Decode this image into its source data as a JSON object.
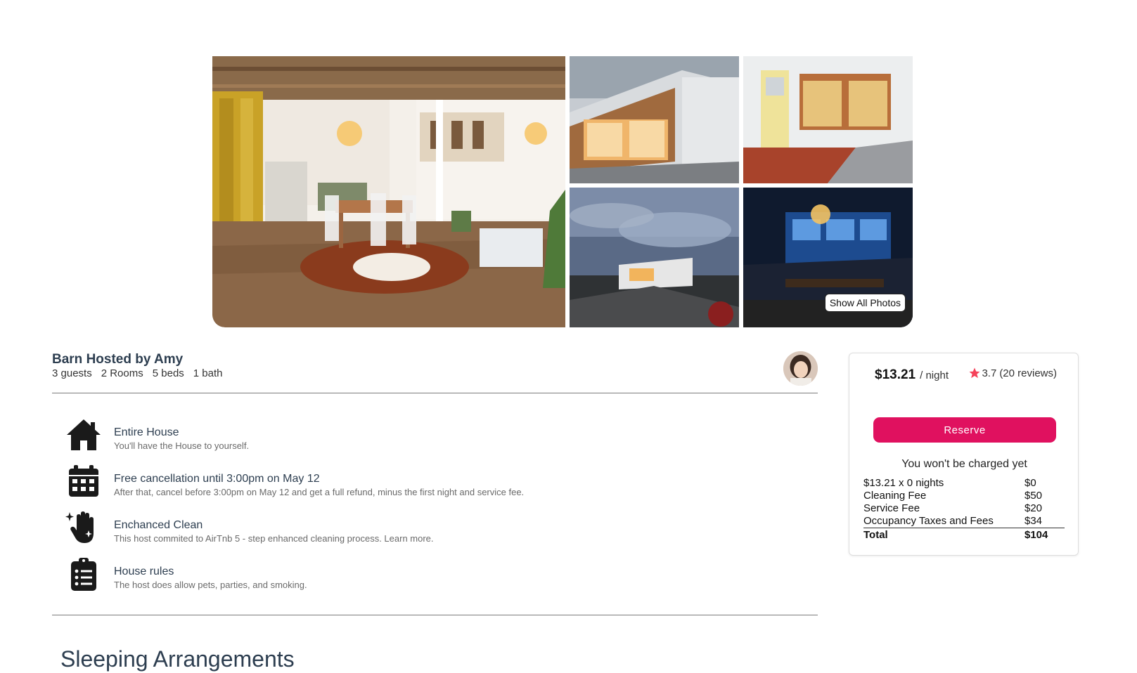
{
  "gallery": {
    "photos": [
      {
        "icon": "photo-barn-interior",
        "alt": ""
      },
      {
        "icon": "photo-barn-exterior-garage",
        "alt": ""
      },
      {
        "icon": "photo-barn-entrance-door",
        "alt": ""
      },
      {
        "icon": "photo-barn-dusk",
        "alt": ""
      },
      {
        "icon": "photo-barn-night-dining",
        "alt": ""
      }
    ],
    "show_all_label": "Show All Photos"
  },
  "listing": {
    "title": "Barn Hosted by Amy",
    "specs": [
      "3 guests",
      "2 Rooms",
      "5 beds",
      "1 bath"
    ],
    "host_avatar_icon": "host-avatar"
  },
  "highlights": [
    {
      "icon": "house-icon",
      "title": "Entire House",
      "subtitle": "You'll have the House to yourself."
    },
    {
      "icon": "calendar-icon",
      "title": "Free cancellation until 3:00pm on May 12",
      "subtitle": "After that, cancel before 3:00pm on May 12 and get a full refund, minus the first night and service fee."
    },
    {
      "icon": "sparkle-hand-icon",
      "title": "Enchanced Clean",
      "subtitle": "This host commited to AirTnb 5 - step enhanced cleaning process. Learn more."
    },
    {
      "icon": "clipboard-list-icon",
      "title": "House rules",
      "subtitle": "The host does allow pets, parties, and smoking."
    }
  ],
  "section_heading": "Sleeping Arrangements",
  "booking": {
    "price": "$13.21",
    "price_unit": "/ night",
    "rating": "3.7",
    "reviews": "(20 reviews)",
    "reserve_label": "Reserve",
    "no_charge_note": "You won't be charged yet",
    "fees": [
      {
        "label": "$13.21 x 0 nights",
        "value": "$0"
      },
      {
        "label": "Cleaning Fee",
        "value": "$50"
      },
      {
        "label": "Service Fee",
        "value": "$20"
      },
      {
        "label": "Occupancy Taxes and Fees",
        "value": "$34"
      }
    ],
    "total_label": "Total",
    "total_value": "$104"
  },
  "colors": {
    "accent": "#e0115f",
    "star": "#f5425a",
    "title": "#2d3e50"
  }
}
